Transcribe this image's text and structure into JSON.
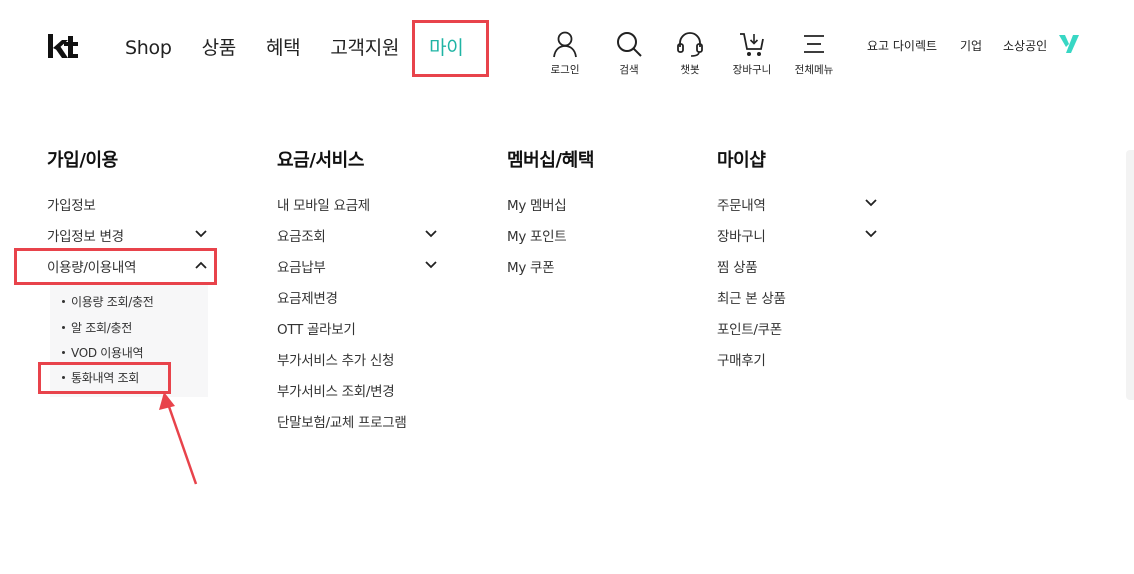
{
  "header": {
    "logo_text": "kt",
    "gnb": [
      {
        "label": "Shop"
      },
      {
        "label": "상품"
      },
      {
        "label": "혜택"
      },
      {
        "label": "고객지원"
      },
      {
        "label": "마이"
      }
    ],
    "utilities": [
      {
        "label": "로그인",
        "icon": "user-icon"
      },
      {
        "label": "검색",
        "icon": "search-icon"
      },
      {
        "label": "챗봇",
        "icon": "headset-icon"
      },
      {
        "label": "장바구니",
        "icon": "cart-icon"
      },
      {
        "label": "전체메뉴",
        "icon": "hamburger-menu-icon"
      }
    ],
    "right_links": [
      "요고 다이렉트",
      "기업",
      "소상공인"
    ],
    "accent_color": "#1fb4a4",
    "highlight_color": "#e8434b"
  },
  "menu": {
    "col1": {
      "title": "가입/이용",
      "items": [
        "가입정보",
        "가입정보 변경",
        "이용량/이용내역"
      ],
      "submenu": [
        "이용량 조회/충전",
        "알 조회/충전",
        "VOD 이용내역",
        "통화내역 조회"
      ]
    },
    "col2": {
      "title": "요금/서비스",
      "items": [
        "내 모바일 요금제",
        "요금조회",
        "요금납부",
        "요금제변경",
        "OTT 골라보기",
        "부가서비스 추가 신청",
        "부가서비스 조회/변경",
        "단말보험/교체 프로그램"
      ]
    },
    "col3": {
      "title": "멤버십/혜택",
      "items": [
        "My 멤버십",
        "My 포인트",
        "My 쿠폰"
      ]
    },
    "col4": {
      "title": "마이샵",
      "items": [
        "주문내역",
        "장바구니",
        "찜 상품",
        "최근 본 상품",
        "포인트/쿠폰",
        "구매후기"
      ]
    }
  }
}
